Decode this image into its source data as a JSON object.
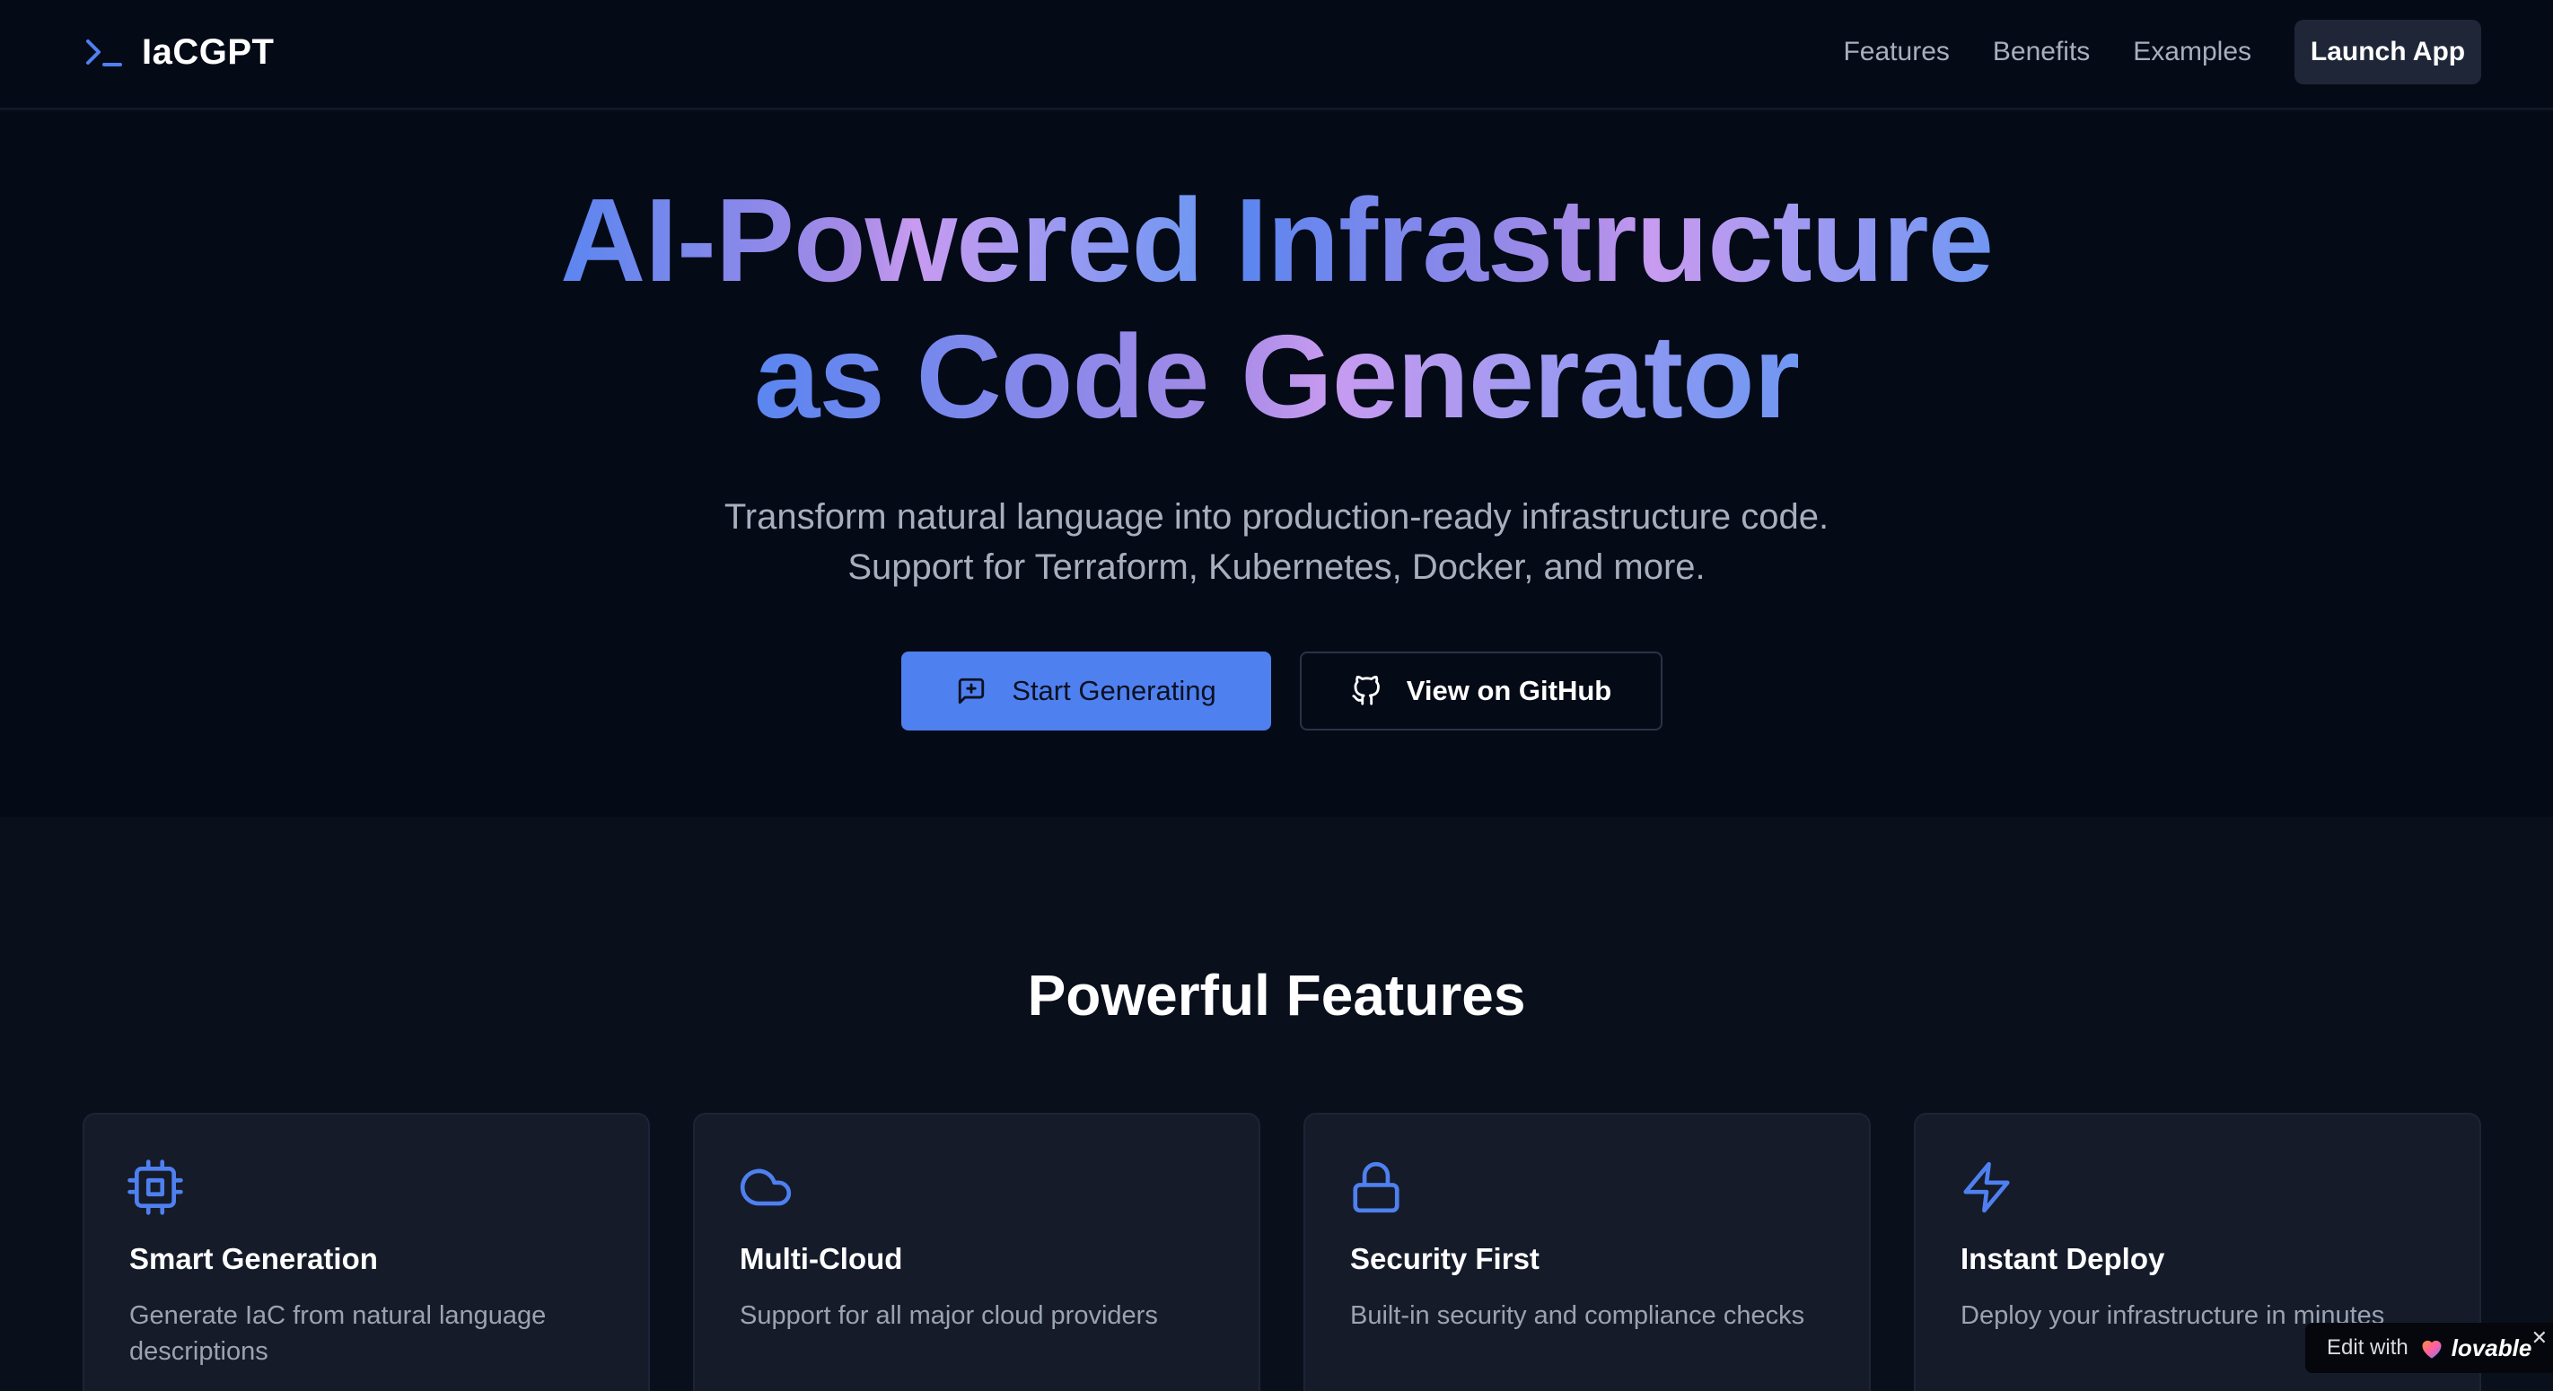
{
  "brand": {
    "name": "IaCGPT",
    "icon": "terminal-prompt-icon"
  },
  "nav": {
    "links": [
      "Features",
      "Benefits",
      "Examples"
    ],
    "cta": "Launch App"
  },
  "hero": {
    "title_line1_a": "AI-Powered",
    "title_line1_b": "Infrastructure",
    "title_line2": "as Code Generator",
    "subtitle_line1": "Transform natural language into production-ready infrastructure code.",
    "subtitle_line2": "Support for Terraform, Kubernetes, Docker, and more.",
    "primary_button": "Start Generating",
    "primary_icon": "message-plus-icon",
    "secondary_button": "View on GitHub",
    "secondary_icon": "github-icon"
  },
  "features": {
    "title": "Powerful Features",
    "cards": [
      {
        "title": "Smart Generation",
        "description": "Generate IaC from natural language descriptions",
        "icon": "cpu-icon"
      },
      {
        "title": "Multi-Cloud",
        "description": "Support for all major cloud providers",
        "icon": "cloud-icon"
      },
      {
        "title": "Security First",
        "description": "Built-in security and compliance checks",
        "icon": "lock-icon"
      },
      {
        "title": "Instant Deploy",
        "description": "Deploy your infrastructure in minutes",
        "icon": "lightning-icon"
      }
    ]
  },
  "badge": {
    "text": "Edit with",
    "brand": "lovable",
    "close": "✕"
  },
  "colors": {
    "background": "#050a17",
    "section": "#0a0f1c",
    "accent": "#4f80f0",
    "card": "#151b29",
    "muted_text": "#a7afbd"
  }
}
